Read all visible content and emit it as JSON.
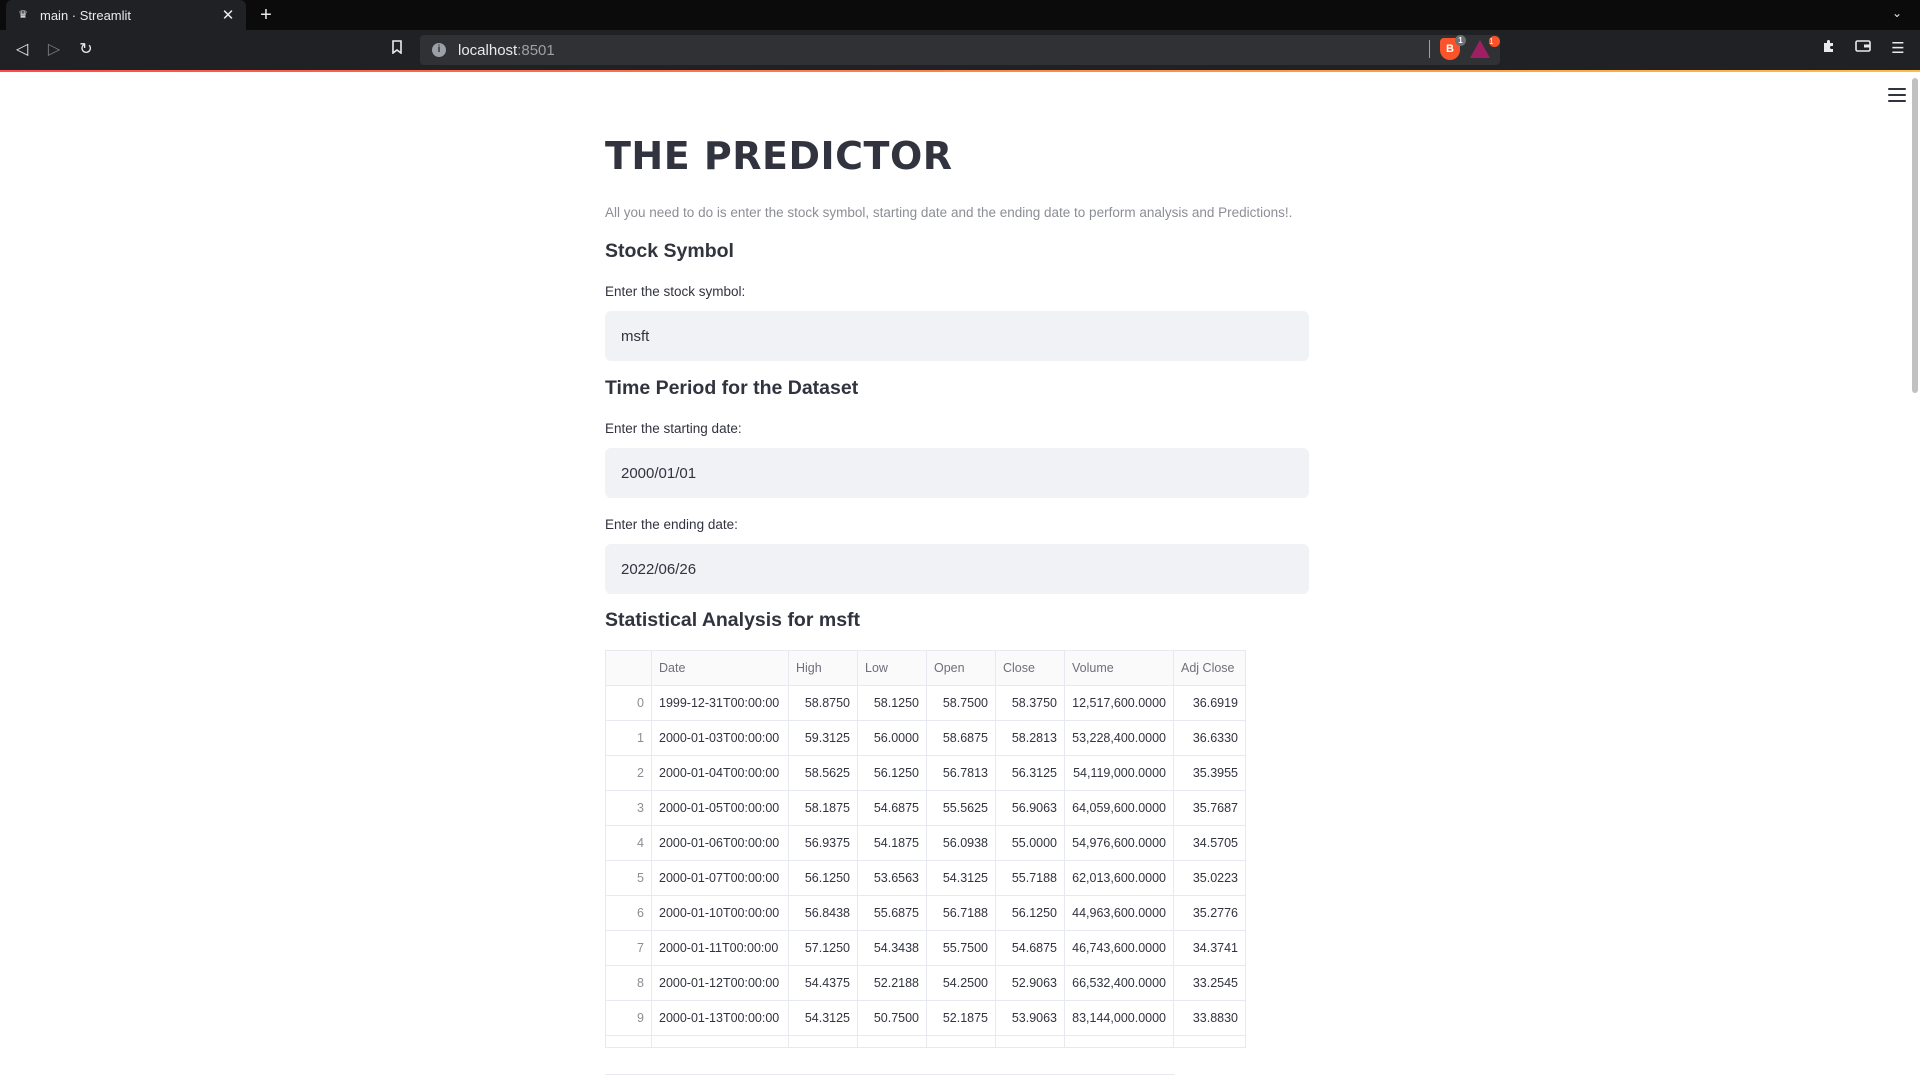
{
  "browser": {
    "tab_title": "main · Streamlit",
    "favicon": "crown-icon",
    "url_host": "localhost",
    "url_port": ":8501",
    "shield_count": "1",
    "rewards_count": "1"
  },
  "app": {
    "title": "THE PREDICTOR",
    "caption": "All you need to do is enter the stock symbol, starting date and the ending date to perform analysis and Predictions!.",
    "stock_section": {
      "header": "Stock Symbol",
      "label": "Enter the stock symbol:",
      "value": "msft"
    },
    "time_section": {
      "header": "Time Period for the Dataset",
      "start_label": "Enter the starting date:",
      "start_value": "2000/01/01",
      "end_label": "Enter the ending date:",
      "end_value": "2022/06/26"
    },
    "analysis_header": "Statistical Analysis for msft",
    "table": {
      "columns": [
        "",
        "Date",
        "High",
        "Low",
        "Open",
        "Close",
        "Volume",
        "Adj Close"
      ],
      "rows": [
        [
          "0",
          "1999-12-31T00:00:00",
          "58.8750",
          "58.1250",
          "58.7500",
          "58.3750",
          "12,517,600.0000",
          "36.6919"
        ],
        [
          "1",
          "2000-01-03T00:00:00",
          "59.3125",
          "56.0000",
          "58.6875",
          "58.2813",
          "53,228,400.0000",
          "36.6330"
        ],
        [
          "2",
          "2000-01-04T00:00:00",
          "58.5625",
          "56.1250",
          "56.7813",
          "56.3125",
          "54,119,000.0000",
          "35.3955"
        ],
        [
          "3",
          "2000-01-05T00:00:00",
          "58.1875",
          "54.6875",
          "55.5625",
          "56.9063",
          "64,059,600.0000",
          "35.7687"
        ],
        [
          "4",
          "2000-01-06T00:00:00",
          "56.9375",
          "54.1875",
          "56.0938",
          "55.0000",
          "54,976,600.0000",
          "34.5705"
        ],
        [
          "5",
          "2000-01-07T00:00:00",
          "56.1250",
          "53.6563",
          "54.3125",
          "55.7188",
          "62,013,600.0000",
          "35.0223"
        ],
        [
          "6",
          "2000-01-10T00:00:00",
          "56.8438",
          "55.6875",
          "56.7188",
          "56.1250",
          "44,963,600.0000",
          "35.2776"
        ],
        [
          "7",
          "2000-01-11T00:00:00",
          "57.1250",
          "54.3438",
          "55.7500",
          "54.6875",
          "46,743,600.0000",
          "34.3741"
        ],
        [
          "8",
          "2000-01-12T00:00:00",
          "54.4375",
          "52.2188",
          "54.2500",
          "52.9063",
          "66,532,400.0000",
          "33.2545"
        ],
        [
          "9",
          "2000-01-13T00:00:00",
          "54.3125",
          "50.7500",
          "52.1875",
          "53.9063",
          "83,144,000.0000",
          "33.8830"
        ]
      ]
    }
  },
  "colors": {
    "text": "#31333f",
    "input_bg": "#f0f2f6",
    "accent_start": "#ff4b4b",
    "accent_end": "#ffbd45"
  }
}
